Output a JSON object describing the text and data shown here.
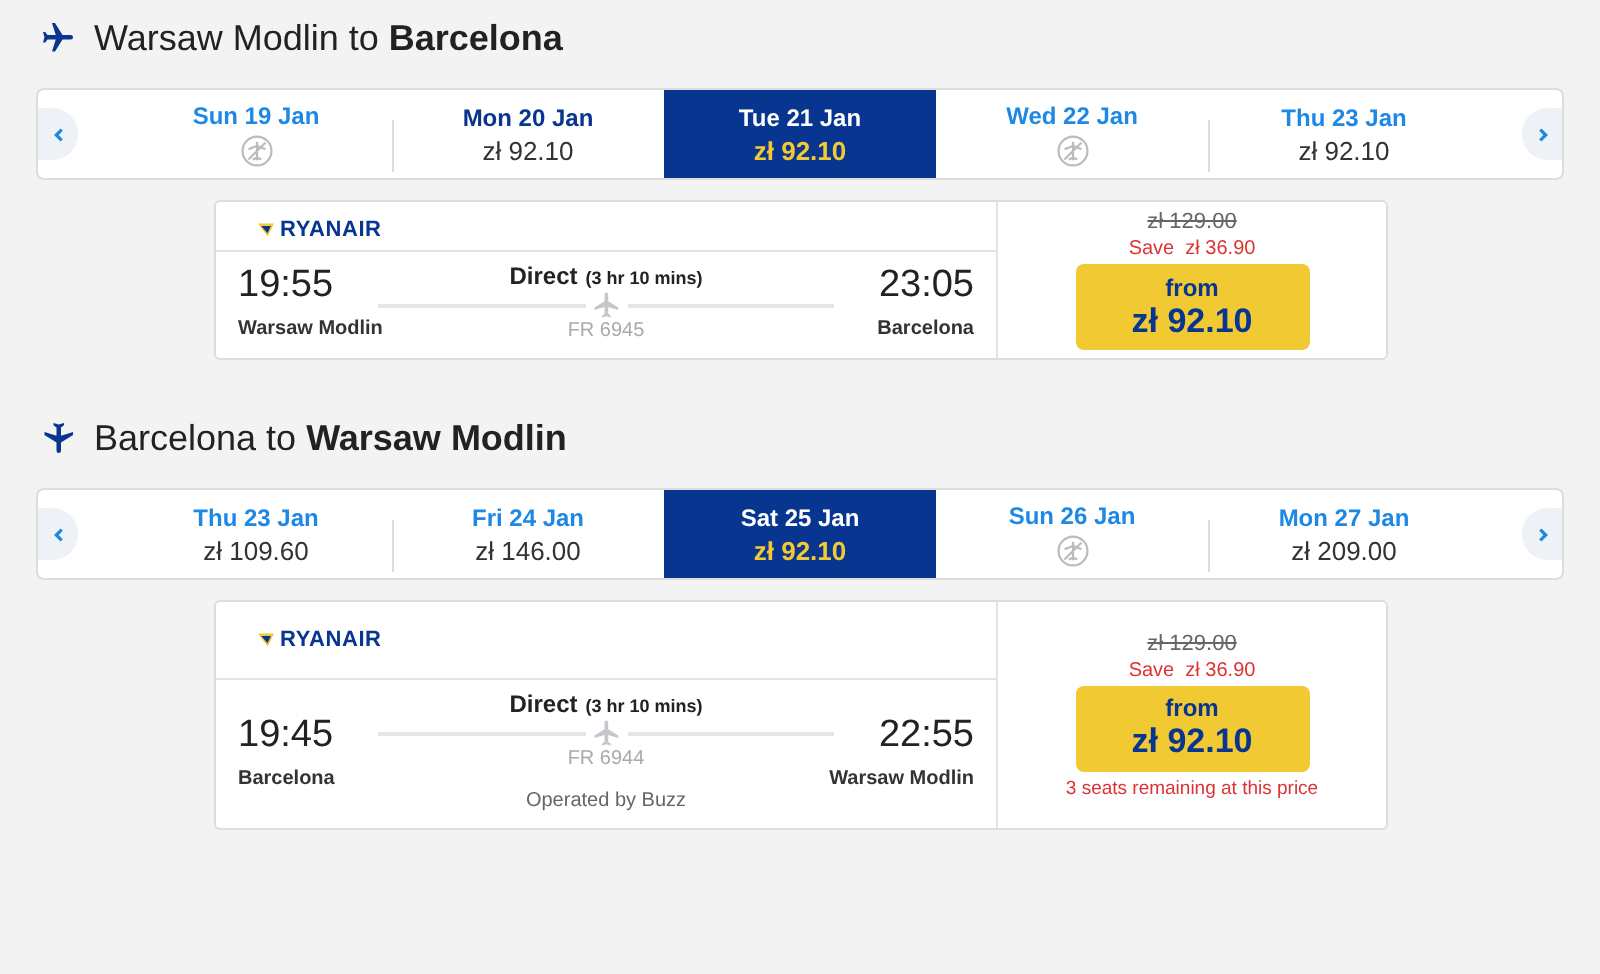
{
  "journeys": [
    {
      "origin": "Warsaw Modlin",
      "connector": "to",
      "destination": "Barcelona",
      "days": [
        {
          "label": "Sun 19 Jan",
          "color": "#1e88e5",
          "no_flights": true,
          "selected": false
        },
        {
          "label": "Mon 20 Jan",
          "color": "#073590",
          "price": "zł 92.10",
          "no_flights": false,
          "selected": false
        },
        {
          "label": "Tue 21 Jan",
          "color": "#ffffff",
          "price": "zł 92.10",
          "no_flights": false,
          "selected": true
        },
        {
          "label": "Wed 22 Jan",
          "color": "#1e88e5",
          "no_flights": true,
          "selected": false
        },
        {
          "label": "Thu 23 Jan",
          "color": "#1e88e5",
          "price": "zł 92.10",
          "no_flights": false,
          "selected": false
        }
      ],
      "flight": {
        "airline": "RYANAIR",
        "type": "Direct",
        "duration": "(3 hr 10 mins)",
        "depart_time": "19:55",
        "depart_place": "Warsaw Modlin",
        "arrive_time": "23:05",
        "arrive_place": "Barcelona",
        "number": "FR 6945",
        "old_price": "zł 129.00",
        "save_label": "Save",
        "save_amount": "zł 36.90",
        "from": "from",
        "price": "zł 92.10"
      }
    },
    {
      "origin": "Barcelona",
      "connector": "to",
      "destination": "Warsaw Modlin",
      "days": [
        {
          "label": "Thu 23 Jan",
          "color": "#1e88e5",
          "price": "zł 109.60",
          "no_flights": false,
          "selected": false
        },
        {
          "label": "Fri 24 Jan",
          "color": "#1e88e5",
          "price": "zł 146.00",
          "no_flights": false,
          "selected": false
        },
        {
          "label": "Sat 25 Jan",
          "color": "#ffffff",
          "price": "zł 92.10",
          "no_flights": false,
          "selected": true
        },
        {
          "label": "Sun 26 Jan",
          "color": "#1e88e5",
          "no_flights": true,
          "selected": false
        },
        {
          "label": "Mon 27 Jan",
          "color": "#1e88e5",
          "price": "zł 209.00",
          "no_flights": false,
          "selected": false
        }
      ],
      "flight": {
        "airline": "RYANAIR",
        "type": "Direct",
        "duration": "(3 hr 10 mins)",
        "depart_time": "19:45",
        "depart_place": "Barcelona",
        "arrive_time": "22:55",
        "arrive_place": "Warsaw Modlin",
        "number": "FR 6944",
        "operator": "Operated by Buzz",
        "old_price": "zł 129.00",
        "save_label": "Save",
        "save_amount": "zł 36.90",
        "from": "from",
        "price": "zł 92.10",
        "seats_note": "3 seats remaining at this price"
      }
    }
  ]
}
